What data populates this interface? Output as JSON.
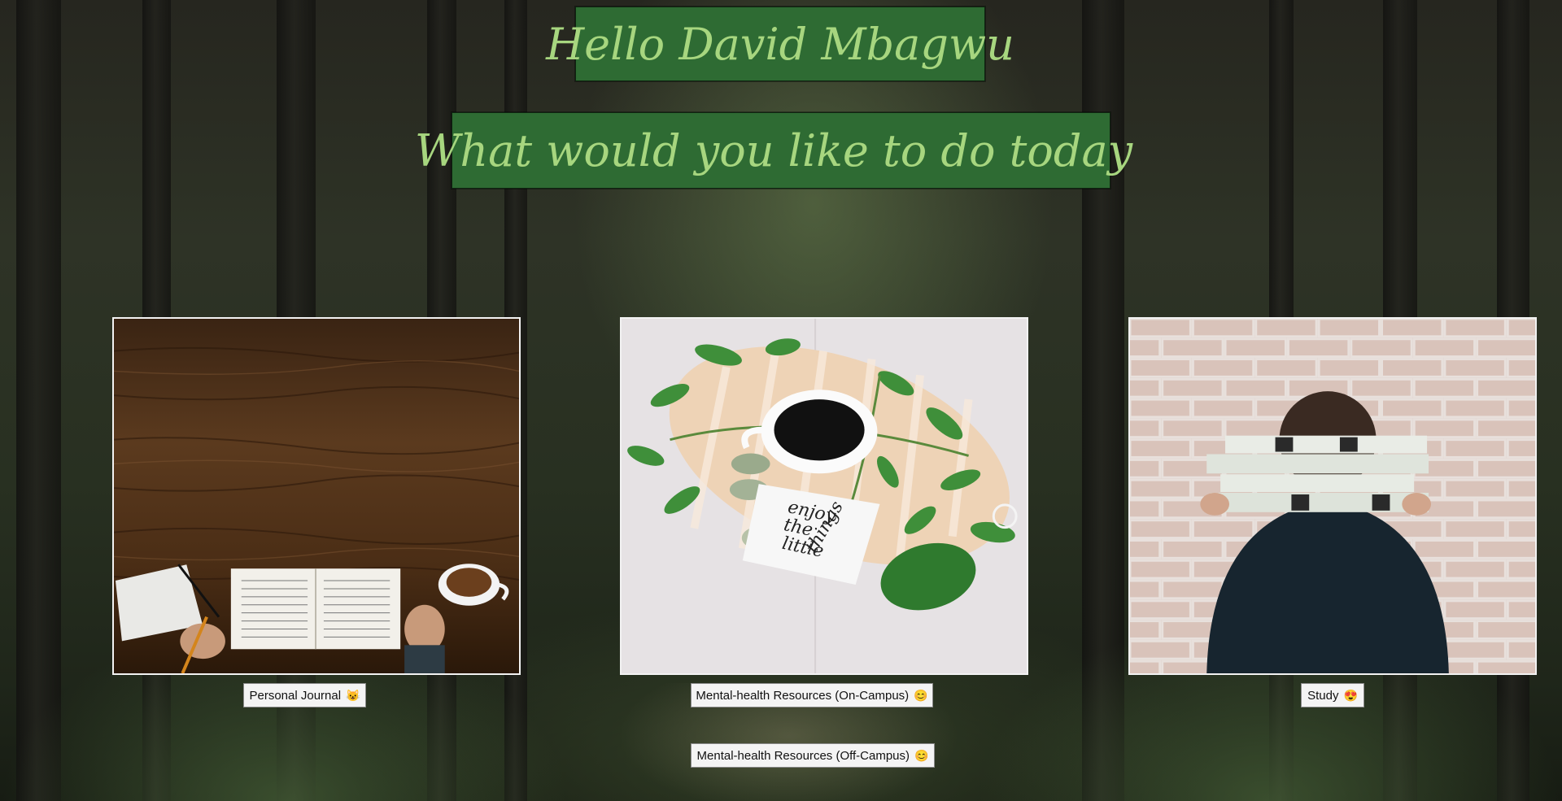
{
  "header": {
    "greeting": "Hello David Mbagwu",
    "question": "What would you like to do today"
  },
  "activities": [
    {
      "label": "Personal Journal",
      "emoji": "😺"
    },
    {
      "label": "Mental-health Resources (On-Campus)",
      "emoji": "😊"
    },
    {
      "label": "Study",
      "emoji": "😍"
    }
  ],
  "extra_button": {
    "label": "Mental-health Resources (Off-Campus)",
    "emoji": "😊"
  },
  "images": {
    "journal_image": "wooden-desk-open-book-coffee",
    "wellness_image": "coffee-cup-leaves-enjoy-the-little-things",
    "study_image": "person-holding-books-brick-wall"
  },
  "wellness_note": [
    "enjoy",
    "the",
    "little",
    "things"
  ],
  "colors": {
    "banner_bg": "#2e6b33",
    "banner_text": "#a7d67f",
    "button_bg": "#f4f4f4"
  }
}
